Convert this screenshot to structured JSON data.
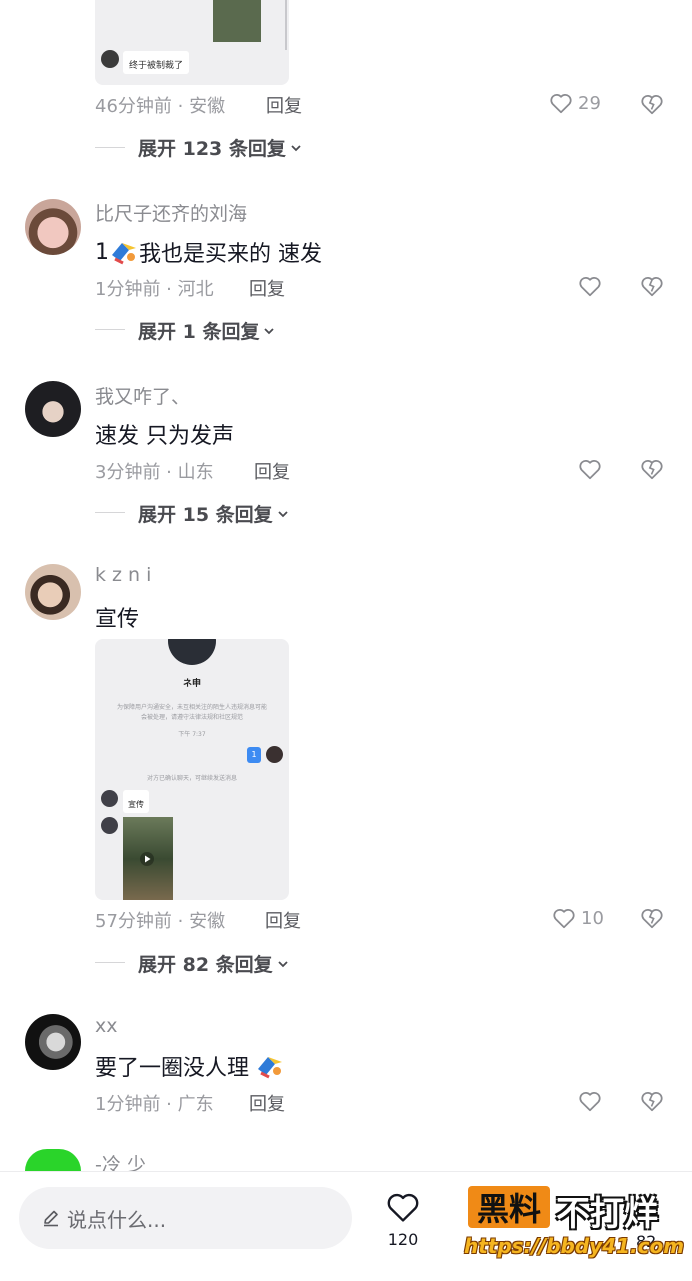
{
  "comments": [
    {
      "meta": "46分钟前 · 安徽",
      "reply_label": "回复",
      "like_count": "29",
      "expand_label": "展开 123 条回复",
      "image": {
        "caption": "终于被制裁了"
      }
    },
    {
      "username": "比尺子还齐的刘海",
      "text_prefix": "1",
      "text": "我也是买来的 速发",
      "meta": "1分钟前 · 河北",
      "reply_label": "回复",
      "expand_label": "展开 1 条回复"
    },
    {
      "username": "我又咋了、",
      "text": "速发 只为发声",
      "meta": "3分钟前 · 山东",
      "reply_label": "回复",
      "expand_label": "展开 15 条回复"
    },
    {
      "username": "k z n i",
      "text": "宣传",
      "meta": "57分钟前 · 安徽",
      "reply_label": "回复",
      "like_count": "10",
      "expand_label": "展开 82 条回复",
      "image": {
        "chat_name": "ネ申",
        "notice": "为保障用户沟通安全，未互相关注的陌生人违规消息可能会被处理，请遵守法律法规和社区规范",
        "time": "下午 7:37",
        "bubble": "1",
        "status": "对方已确认聊天，可继续发送消息",
        "message": "宣传"
      }
    },
    {
      "username": "xx",
      "text": "要了一圈没人理",
      "meta": "1分钟前 · 广东",
      "reply_label": "回复"
    },
    {
      "username": "-冷 少"
    }
  ],
  "bottom_bar": {
    "input_placeholder": "说点什么...",
    "like_count": "120",
    "second_count": "82"
  },
  "watermark": {
    "logo_text": "黑料",
    "logo_rest": "不打烊",
    "url": "https://bbdy41.com"
  },
  "colors": {
    "accent": "#fe2c55",
    "watermark_orange": "#f08a16"
  }
}
